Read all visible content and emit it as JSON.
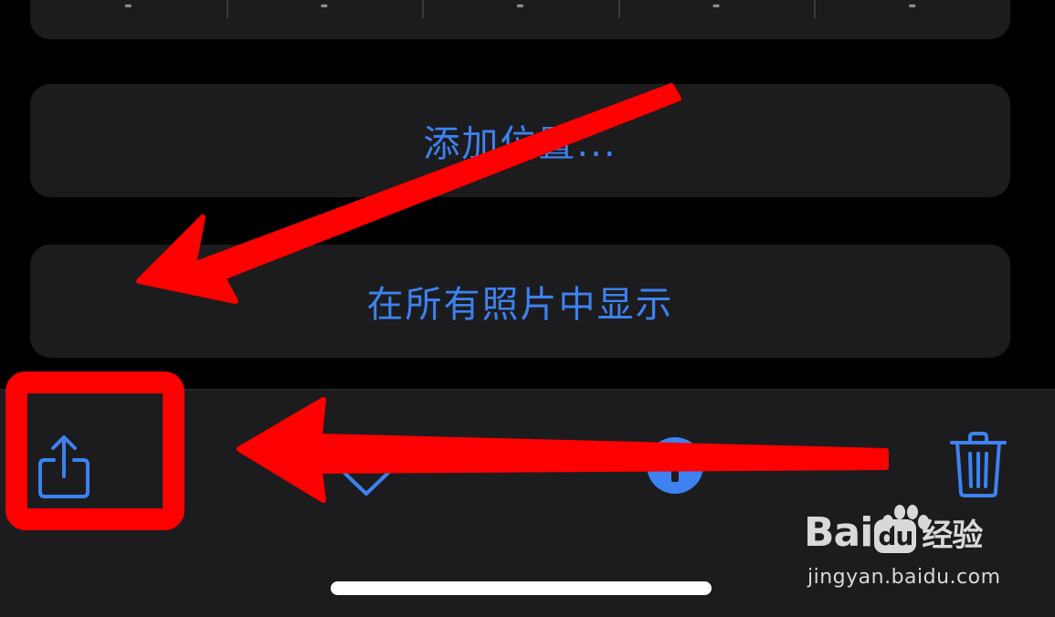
{
  "top_row": {
    "cells": [
      "-",
      "-",
      "-",
      "-",
      "-"
    ]
  },
  "actions": {
    "add_location_label": "添加位置...",
    "show_in_all_photos_label": "在所有照片中显示"
  },
  "toolbar": {
    "share_icon": "share-icon",
    "favorite_icon": "heart-icon",
    "info_icon": "info-icon",
    "delete_icon": "trash-icon"
  },
  "colors": {
    "accent": "#3d82f0",
    "card_background": "#1c1c1e",
    "annotation": "#ff0000"
  },
  "watermark": {
    "brand": "Bai",
    "brand_du": "du",
    "brand_cn": "经验",
    "url": "jingyan.baidu.com"
  }
}
